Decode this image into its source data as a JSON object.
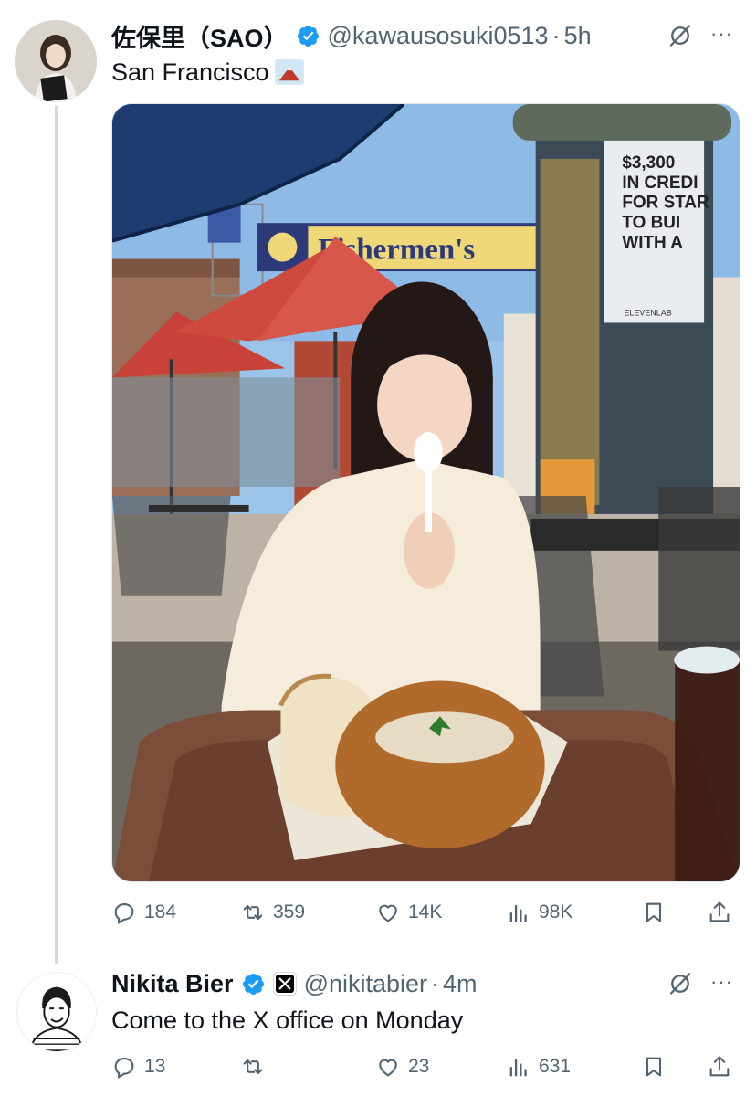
{
  "tweet1": {
    "author": {
      "display_name": "佐保里（SAO）",
      "handle": "@kawausosuki0513",
      "time": "5h"
    },
    "text": "San Francisco",
    "photo": {
      "sign_text": "Fishermen's",
      "kiosk_text": [
        "$3,300",
        "IN CREDI",
        "FOR STAR",
        "TO BUI",
        "WITH A"
      ],
      "kiosk_small": "ELEVENLAB"
    },
    "stats": {
      "replies": "184",
      "reposts": "359",
      "likes": "14K",
      "views": "98K"
    }
  },
  "tweet2": {
    "author": {
      "display_name": "Nikita Bier",
      "handle": "@nikitabier",
      "time": "4m"
    },
    "text": "Come to the X office on Monday",
    "stats": {
      "replies": "13",
      "reposts": "",
      "likes": "23",
      "views": "631"
    }
  },
  "separator": "·",
  "icons": [
    "verified-badge-icon",
    "x-affiliate-badge-icon",
    "grok-icon",
    "more-icon",
    "reply-icon",
    "repost-icon",
    "like-icon",
    "views-icon",
    "bookmark-icon",
    "share-icon"
  ],
  "colors": {
    "verified": "#1d9bf0",
    "muted": "#536471",
    "text": "#0f1419"
  }
}
